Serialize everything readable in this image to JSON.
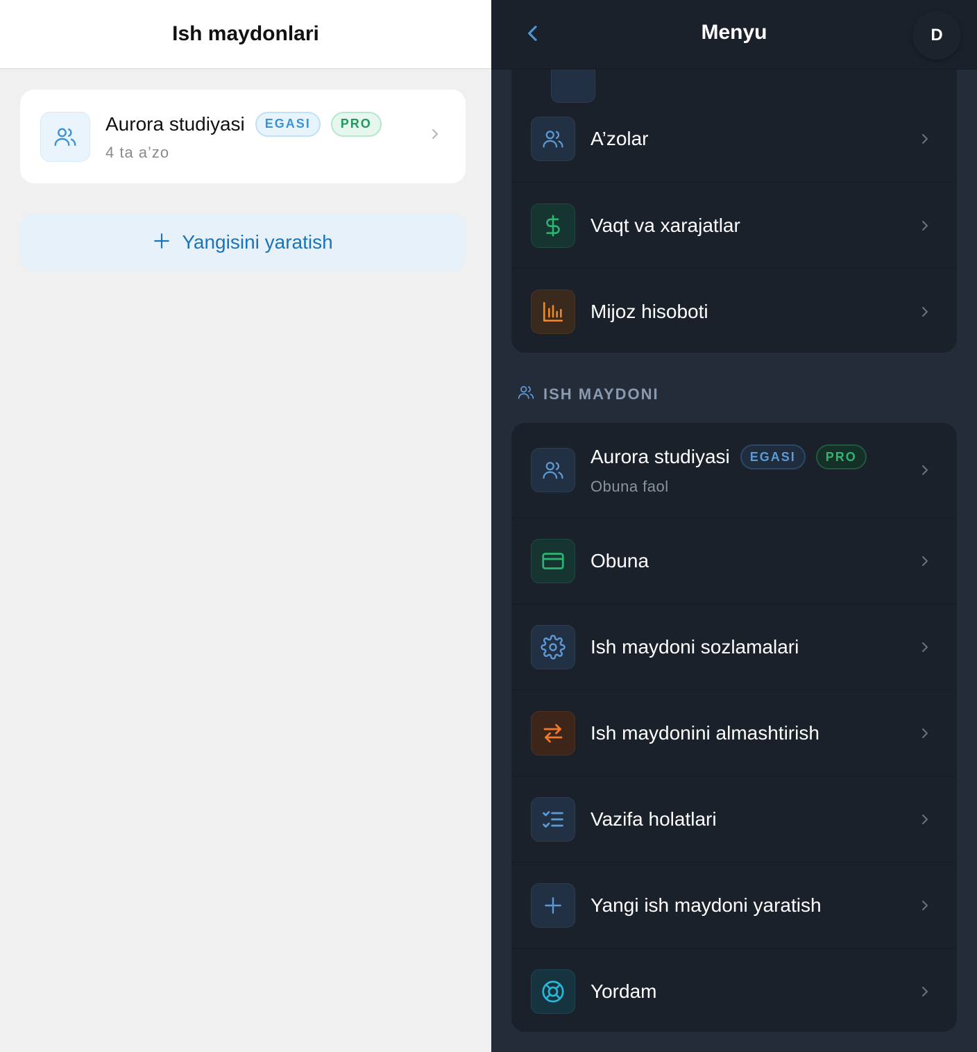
{
  "left": {
    "title": "Ish maydonlari",
    "workspace": {
      "name": "Aurora studiyasi",
      "badge_owner": "EGASI",
      "badge_plan": "PRO",
      "subtitle": "4 ta a’zo"
    },
    "create_button": "Yangisini yaratish"
  },
  "right": {
    "title": "Menyu",
    "avatar_letter": "D",
    "section1": [
      {
        "label": "A’zolar",
        "icon": "users-icon"
      },
      {
        "label": "Vaqt va xarajatlar",
        "icon": "dollar-icon"
      },
      {
        "label": "Mijoz hisoboti",
        "icon": "bar-chart-icon"
      }
    ],
    "section2_title": "ISH MAYDONI",
    "workspace": {
      "name": "Aurora studiyasi",
      "badge_owner": "EGASI",
      "badge_plan": "PRO",
      "subtitle": "Obuna faol"
    },
    "section2": [
      {
        "label": "Obuna",
        "icon": "credit-card-icon"
      },
      {
        "label": "Ish maydoni sozlamalari",
        "icon": "gear-icon"
      },
      {
        "label": "Ish maydonini almashtirish",
        "icon": "switch-arrows-icon"
      },
      {
        "label": "Vazifa holatlari",
        "icon": "checklist-icon"
      },
      {
        "label": "Yangi ish maydoni yaratish",
        "icon": "plus-icon"
      },
      {
        "label": "Yordam",
        "icon": "lifebuoy-icon"
      }
    ]
  },
  "colors": {
    "accent_blue": "#4f95d6",
    "accent_green": "#2bb673",
    "accent_orange": "#f08a2b",
    "accent_cyan": "#2bb6d6"
  }
}
